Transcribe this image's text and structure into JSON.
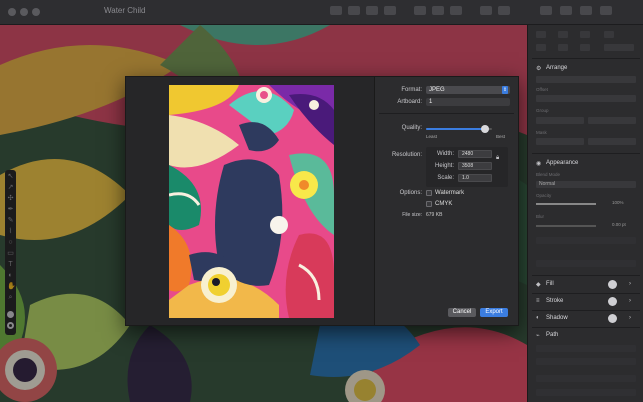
{
  "window": {
    "title": "Water Child"
  },
  "export_dialog": {
    "format_label": "Format:",
    "format_value": "JPEG",
    "artboard_label": "Artboard:",
    "artboard_value": "1",
    "quality_label": "Quality:",
    "quality_value": 0.9,
    "quality_min_label": "Least",
    "quality_max_label": "Best",
    "resolution_label": "Resolution:",
    "width_label": "Width:",
    "width_value": "2480",
    "height_label": "Height:",
    "height_value": "3508",
    "scale_label": "Scale:",
    "scale_value": "1.0",
    "options_label": "Options:",
    "watermark_label": "Watermark",
    "cmyk_label": "CMYK",
    "filesize_label": "File size:",
    "filesize_value": "679 KB",
    "cancel_label": "Cancel",
    "export_label": "Export"
  },
  "inspector": {
    "arrange_label": "Arrange",
    "offset_label": "Offset",
    "group_label": "Group",
    "mask_label": "Mask",
    "appearance_label": "Appearance",
    "blend_mode_label": "Blend Mode",
    "blend_mode_value": "Normal",
    "opacity_label": "Opacity",
    "opacity_value": "100%",
    "opacity_level": 1.0,
    "blur_label": "Blur",
    "blur_value": "0.00 pt",
    "fill_label": "Fill",
    "stroke_label": "Stroke",
    "shadow_label": "Shadow",
    "path_label": "Path",
    "accent_color": "#3b7de0"
  }
}
